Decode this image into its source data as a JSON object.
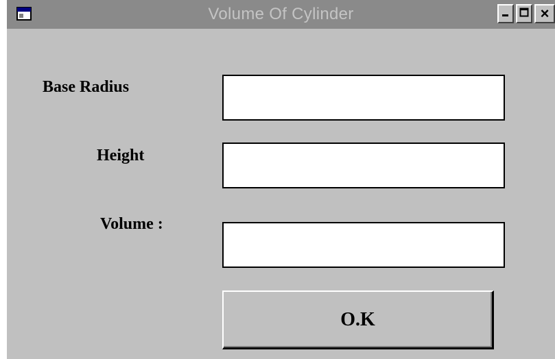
{
  "window": {
    "title": "Volume Of Cylinder",
    "close_glyph": "×"
  },
  "form": {
    "base_radius_label": "Base Radius",
    "height_label": "Height",
    "volume_label": "Volume :",
    "base_radius_value": "",
    "height_value": "",
    "volume_value": "",
    "ok_label": "O.K"
  },
  "icons": {
    "app": "app-window-icon",
    "minimize": "minimize-icon",
    "maximize": "maximize-icon",
    "close": "close-icon"
  },
  "colors": {
    "titlebar": "#8a8a8a",
    "title_text": "#c4c4c4",
    "face": "#c0c0c0",
    "field": "#ffffff"
  }
}
